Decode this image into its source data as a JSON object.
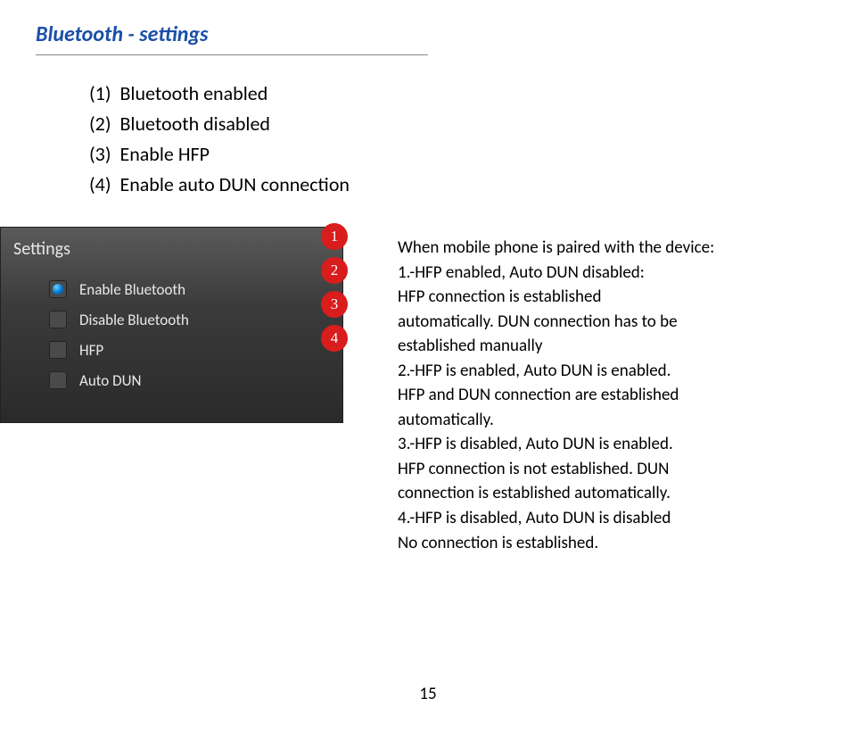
{
  "title": "Bluetooth - settings",
  "list": [
    {
      "num": "(1)",
      "text": "Bluetooth enabled"
    },
    {
      "num": "(2)",
      "text": "Bluetooth disabled"
    },
    {
      "num": "(3)",
      "text": "Enable HFP"
    },
    {
      "num": "(4)",
      "text": "Enable auto DUN connection"
    }
  ],
  "panel": {
    "heading": "Settings",
    "rows": [
      {
        "label": "Enable Bluetooth",
        "checked": true
      },
      {
        "label": "Disable Bluetooth",
        "checked": false
      },
      {
        "label": "HFP",
        "checked": false
      },
      {
        "label": "Auto DUN",
        "checked": false
      }
    ]
  },
  "badges": [
    "1",
    "2",
    "3",
    "4"
  ],
  "explain": {
    "intro": "When mobile phone is paired with the device:",
    "p1a": "1.-HFP enabled, Auto DUN disabled:",
    "p1b": "HFP connection is established",
    "p1c": "automatically. DUN connection has to be",
    "p1d": "established manually",
    "p2a": "2.-HFP is enabled, Auto DUN is enabled.",
    "p2b": "HFP and DUN connection are established",
    "p2c": "automatically.",
    "p3a": "3.-HFP is disabled, Auto DUN is enabled.",
    "p3b": "HFP connection is not established. DUN",
    "p3c": "connection is established automatically.",
    "p4a": "4.-HFP is disabled, Auto DUN is disabled",
    "p4b": "No connection is established."
  },
  "page_number": "15"
}
